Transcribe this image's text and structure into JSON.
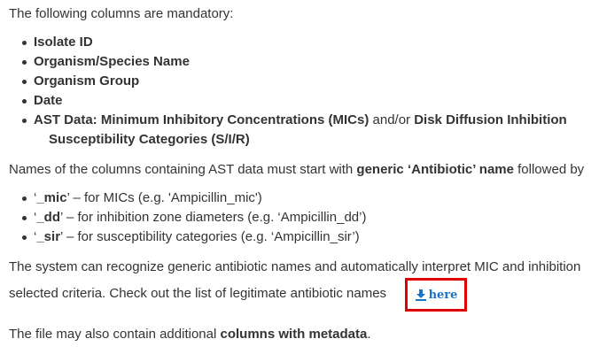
{
  "intro": "The following columns are mandatory:",
  "mandatory_columns": [
    "Isolate ID",
    "Organism/Species Name",
    "Organism Group",
    "Date"
  ],
  "ast_item": {
    "bold1": "AST Data: Minimum Inhibitory Concentrations (MICs)",
    "mid": " and/or ",
    "bold2": "Disk Diffusion Inhibition",
    "line2": "Susceptibility Categories (S/I/R)"
  },
  "names_para": {
    "pre": "Names of the columns containing AST data must start with ",
    "bold": "generic ‘Antibiotic’ name",
    "post": " followed by"
  },
  "suffixes": [
    {
      "q1": "‘",
      "suffix": "_mic",
      "desc": "’ – for MICs (e.g. 'Ampicillin_mic')"
    },
    {
      "q1": "‘",
      "suffix": "_dd",
      "desc": "’ – for inhibition zone diameters (e.g. ‘Ampicillin_dd’)"
    },
    {
      "q1": "‘",
      "suffix": "_sir",
      "desc": "’ – for susceptibility categories (e.g. ‘Ampicillin_sir’)"
    }
  ],
  "system_para": {
    "line1": "The system can recognize generic antibiotic names and automatically interpret MIC and inhibition",
    "line2": "selected criteria. Check out the list of legitimate antibiotic names"
  },
  "here_link": {
    "label": "here",
    "icon": "download-icon",
    "border_color": "#e00000",
    "link_color": "#1a73c8"
  },
  "file_para": {
    "pre": "The file may also contain additional ",
    "bold": "columns with metadata",
    "post": "."
  }
}
